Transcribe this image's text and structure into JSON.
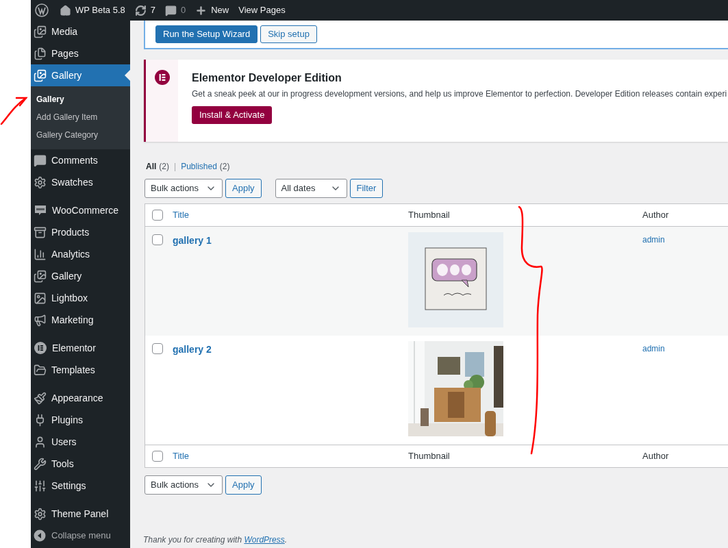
{
  "admin_bar": {
    "site_name": "WP Beta 5.8",
    "updates": "7",
    "comments": "0",
    "new": "New",
    "view": "View Pages"
  },
  "sidebar": {
    "groups": [
      [
        {
          "label": "Media",
          "selected": false
        },
        {
          "label": "Pages",
          "selected": false
        },
        {
          "label": "Gallery",
          "selected": true,
          "submenu": [
            {
              "label": "Gallery",
              "selected": true
            },
            {
              "label": "Add Gallery Item",
              "selected": false
            },
            {
              "label": "Gallery Category",
              "selected": false
            }
          ]
        },
        {
          "label": "Comments",
          "selected": false
        },
        {
          "label": "Swatches",
          "selected": false
        }
      ],
      [
        {
          "label": "WooCommerce",
          "selected": false
        },
        {
          "label": "Products",
          "selected": false
        },
        {
          "label": "Analytics",
          "selected": false
        },
        {
          "label": "Gallery",
          "selected": false
        },
        {
          "label": "Lightbox",
          "selected": false
        },
        {
          "label": "Marketing",
          "selected": false
        }
      ],
      [
        {
          "label": "Elementor",
          "selected": false
        },
        {
          "label": "Templates",
          "selected": false
        }
      ],
      [
        {
          "label": "Appearance",
          "selected": false
        },
        {
          "label": "Plugins",
          "selected": false
        },
        {
          "label": "Users",
          "selected": false
        },
        {
          "label": "Tools",
          "selected": false
        },
        {
          "label": "Settings",
          "selected": false
        }
      ],
      [
        {
          "label": "Theme Panel",
          "selected": false
        }
      ]
    ],
    "collapse": "Collapse menu"
  },
  "setup_notice": {
    "buttons": [
      {
        "label": "Run the Setup Wizard",
        "kind": "primary"
      },
      {
        "label": "Skip setup",
        "kind": "secondary"
      }
    ]
  },
  "elementor_notice": {
    "title": "Elementor Developer Edition",
    "text": "Get a sneak peek at our in progress development versions, and help us improve Elementor to perfection. Developer Edition releases contain experi",
    "button": "Install & Activate"
  },
  "views": {
    "separator": "|",
    "items": [
      {
        "label": "All",
        "count": "(2)",
        "selected": true
      },
      {
        "label": "Published",
        "count": "(2)",
        "selected": false
      }
    ]
  },
  "top_tablenav": {
    "bulk_actions": "Bulk actions",
    "apply": "Apply",
    "date_filter": "All dates",
    "filter": "Filter"
  },
  "table": {
    "columns": [
      "Title",
      "Thumbnail",
      "Author"
    ],
    "footer_columns": [
      "Title",
      "Thumbnail",
      "Author"
    ],
    "header_checked": false,
    "footer_checked": false,
    "rows": [
      {
        "title": "gallery 1",
        "author": "admin",
        "checked": false
      },
      {
        "title": "gallery 2",
        "author": "admin",
        "checked": false
      }
    ]
  },
  "bottom_tablenav": {
    "bulk_actions": "Bulk actions",
    "apply": "Apply"
  },
  "footer": {
    "text": "Thank you for creating with ",
    "link": "WordPress",
    "end": "."
  }
}
